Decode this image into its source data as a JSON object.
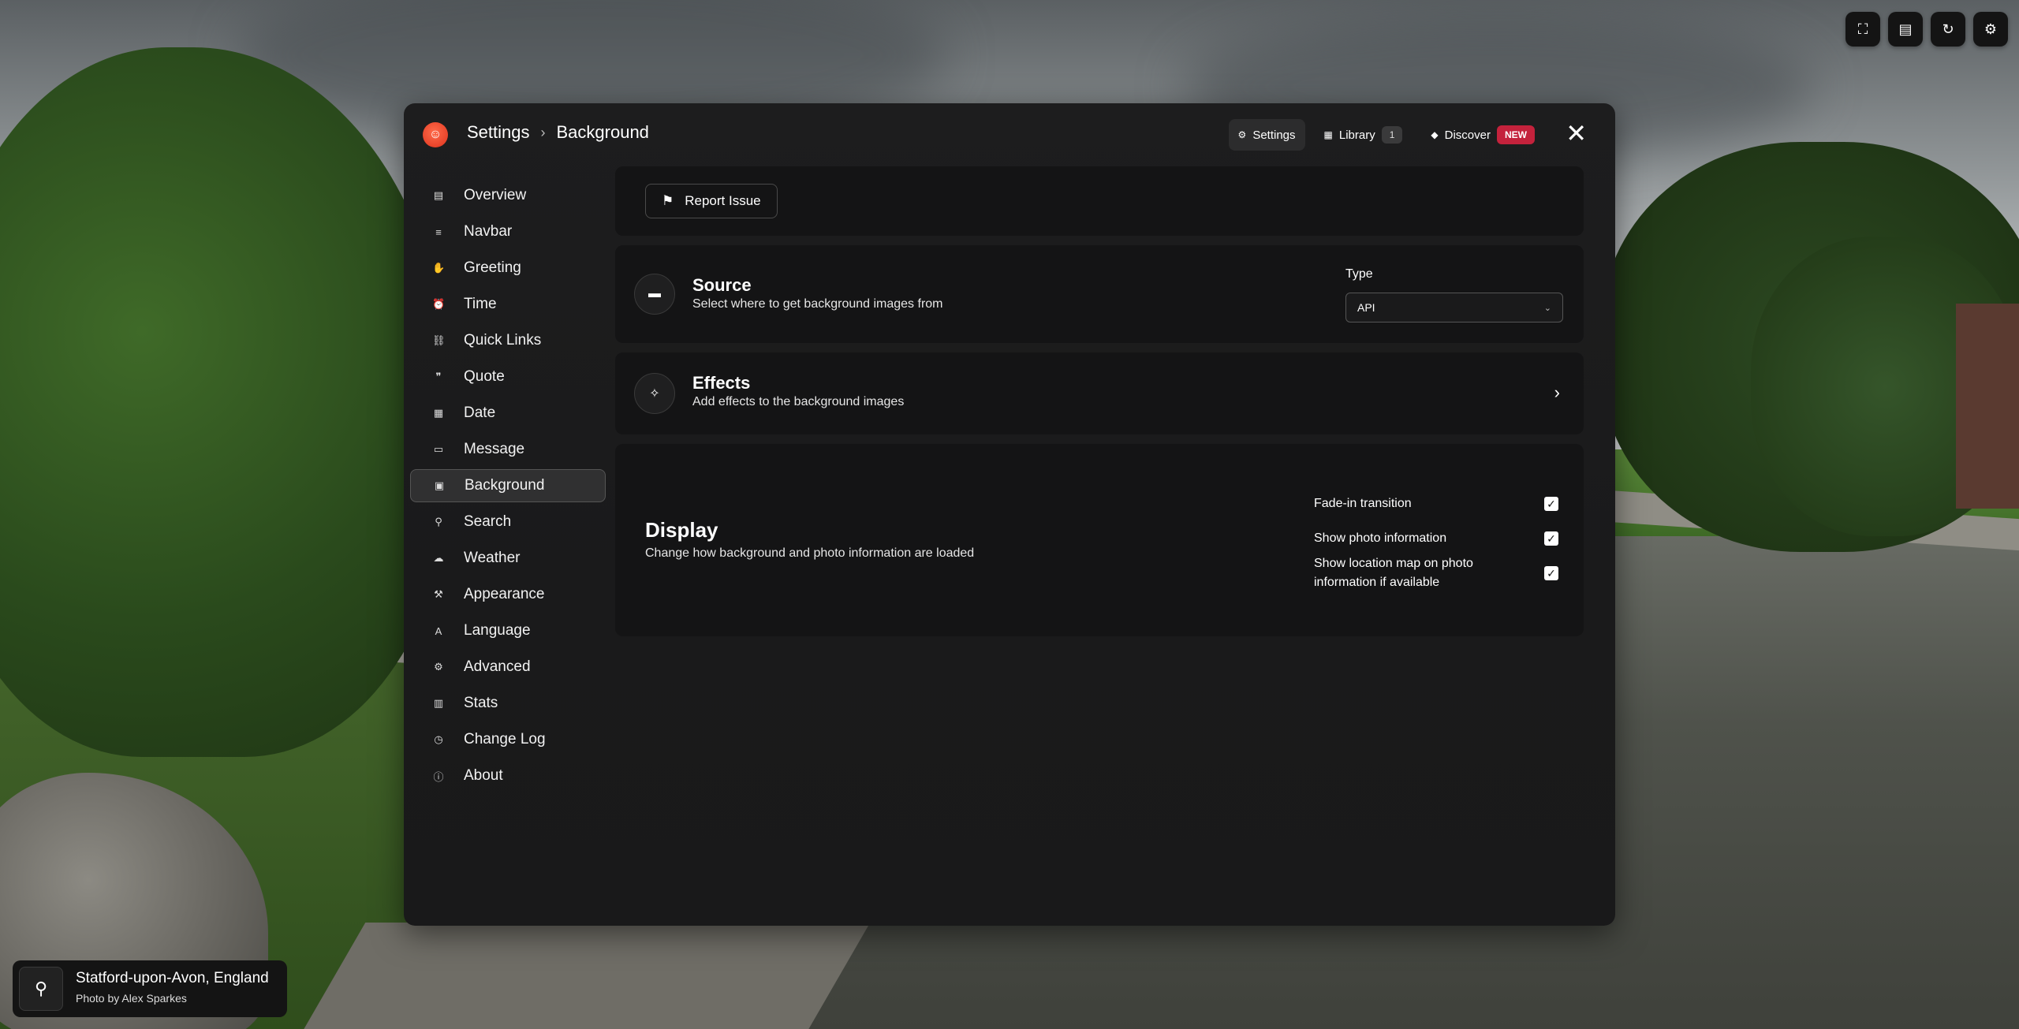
{
  "background": {
    "location": "Statford-upon-Avon, England",
    "credit": "Photo by Alex Sparkes",
    "pin_icon": "location-pin-icon"
  },
  "toolbar": {
    "buttons": [
      {
        "name": "fullscreen-icon",
        "glyph": "⛶"
      },
      {
        "name": "clipboard-icon",
        "glyph": "▤"
      },
      {
        "name": "refresh-icon",
        "glyph": "↻"
      },
      {
        "name": "gear-icon",
        "glyph": "⚙"
      }
    ]
  },
  "modal": {
    "breadcrumb": {
      "root": "Settings",
      "separator": "›",
      "current": "Background"
    },
    "nav": {
      "settings_label": "Settings",
      "library_label": "Library",
      "library_count": "1",
      "discover_label": "Discover",
      "discover_badge": "NEW"
    },
    "close_glyph": "✕"
  },
  "sidebar": {
    "items": [
      {
        "label": "Overview",
        "icon": "▤"
      },
      {
        "label": "Navbar",
        "icon": "≡"
      },
      {
        "label": "Greeting",
        "icon": "✋"
      },
      {
        "label": "Time",
        "icon": "⏰"
      },
      {
        "label": "Quick Links",
        "icon": "⛓"
      },
      {
        "label": "Quote",
        "icon": "❞"
      },
      {
        "label": "Date",
        "icon": "▦"
      },
      {
        "label": "Message",
        "icon": "▭"
      },
      {
        "label": "Background",
        "icon": "▣",
        "active": true
      },
      {
        "label": "Search",
        "icon": "⚲"
      },
      {
        "label": "Weather",
        "icon": "☁"
      },
      {
        "label": "Appearance",
        "icon": "⚒"
      },
      {
        "label": "Language",
        "icon": "A"
      },
      {
        "label": "Advanced",
        "icon": "⚙"
      },
      {
        "label": "Stats",
        "icon": "▥"
      },
      {
        "label": "Change Log",
        "icon": "◷"
      },
      {
        "label": "About",
        "icon": "ⓘ"
      }
    ]
  },
  "report": {
    "label": "Report Issue",
    "icon": "⚑"
  },
  "source": {
    "title": "Source",
    "subtitle": "Select where to get background images from",
    "type_label": "Type",
    "type_value": "API",
    "icon": "▬"
  },
  "effects": {
    "title": "Effects",
    "subtitle": "Add effects to the background images",
    "icon": "✧",
    "arrow": "›"
  },
  "display": {
    "title": "Display",
    "subtitle": "Change how background and photo information are loaded",
    "options": [
      {
        "label": "Fade-in transition",
        "checked": true
      },
      {
        "label": "Show photo information",
        "checked": true
      },
      {
        "label": "Show location map on photo information if available",
        "checked": true
      }
    ]
  }
}
